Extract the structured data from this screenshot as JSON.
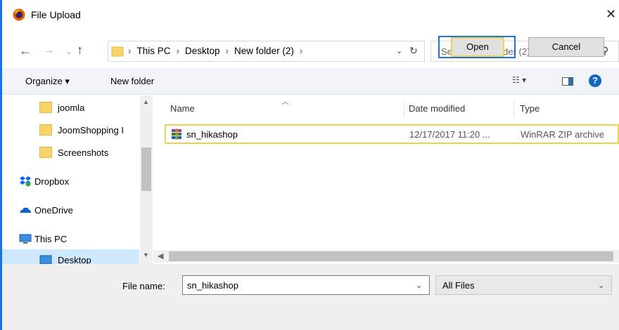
{
  "window": {
    "title": "File Upload",
    "close_glyph": "✕"
  },
  "nav": {
    "back_glyph": "←",
    "forward_glyph": "→",
    "recent_glyph": "⌄",
    "up_glyph": "↑"
  },
  "address": {
    "crumbs": [
      "This PC",
      "Desktop",
      "New folder (2)"
    ],
    "separator": "›",
    "dropdown_glyph": "⌄",
    "refresh_glyph": "↻"
  },
  "search": {
    "placeholder": "Search New folder (2)",
    "icon_glyph": "⚲"
  },
  "toolbar": {
    "organize_label": "Organize ▾",
    "newfolder_label": "New folder",
    "view_glyph": "☷ ▾",
    "help_glyph": "?"
  },
  "sidebar": {
    "items": [
      {
        "label": "joomla",
        "icon": "folder-icon"
      },
      {
        "label": "JoomShopping I",
        "icon": "folder-icon"
      },
      {
        "label": "Screenshots",
        "icon": "folder-icon"
      },
      {
        "label": "Dropbox",
        "icon": "dropbox-icon"
      },
      {
        "label": "OneDrive",
        "icon": "onedrive-icon"
      },
      {
        "label": "This PC",
        "icon": "computer-icon"
      },
      {
        "label": "Desktop",
        "icon": "desktop-icon"
      }
    ]
  },
  "filelist": {
    "columns": [
      "Name",
      "Date modified",
      "Type"
    ],
    "rows": [
      {
        "name": "sn_hikashop",
        "date": "12/17/2017 11:20 ...",
        "type": "WinRAR ZIP archive"
      }
    ]
  },
  "footer": {
    "filename_label": "File name:",
    "filename_value": "sn_hikashop",
    "filter_value": "All Files",
    "open_label": "Open",
    "cancel_label": "Cancel"
  },
  "colors": {
    "accent": "#1a73e8",
    "highlight": "#f0d24d",
    "selected": "#cde8ff"
  }
}
